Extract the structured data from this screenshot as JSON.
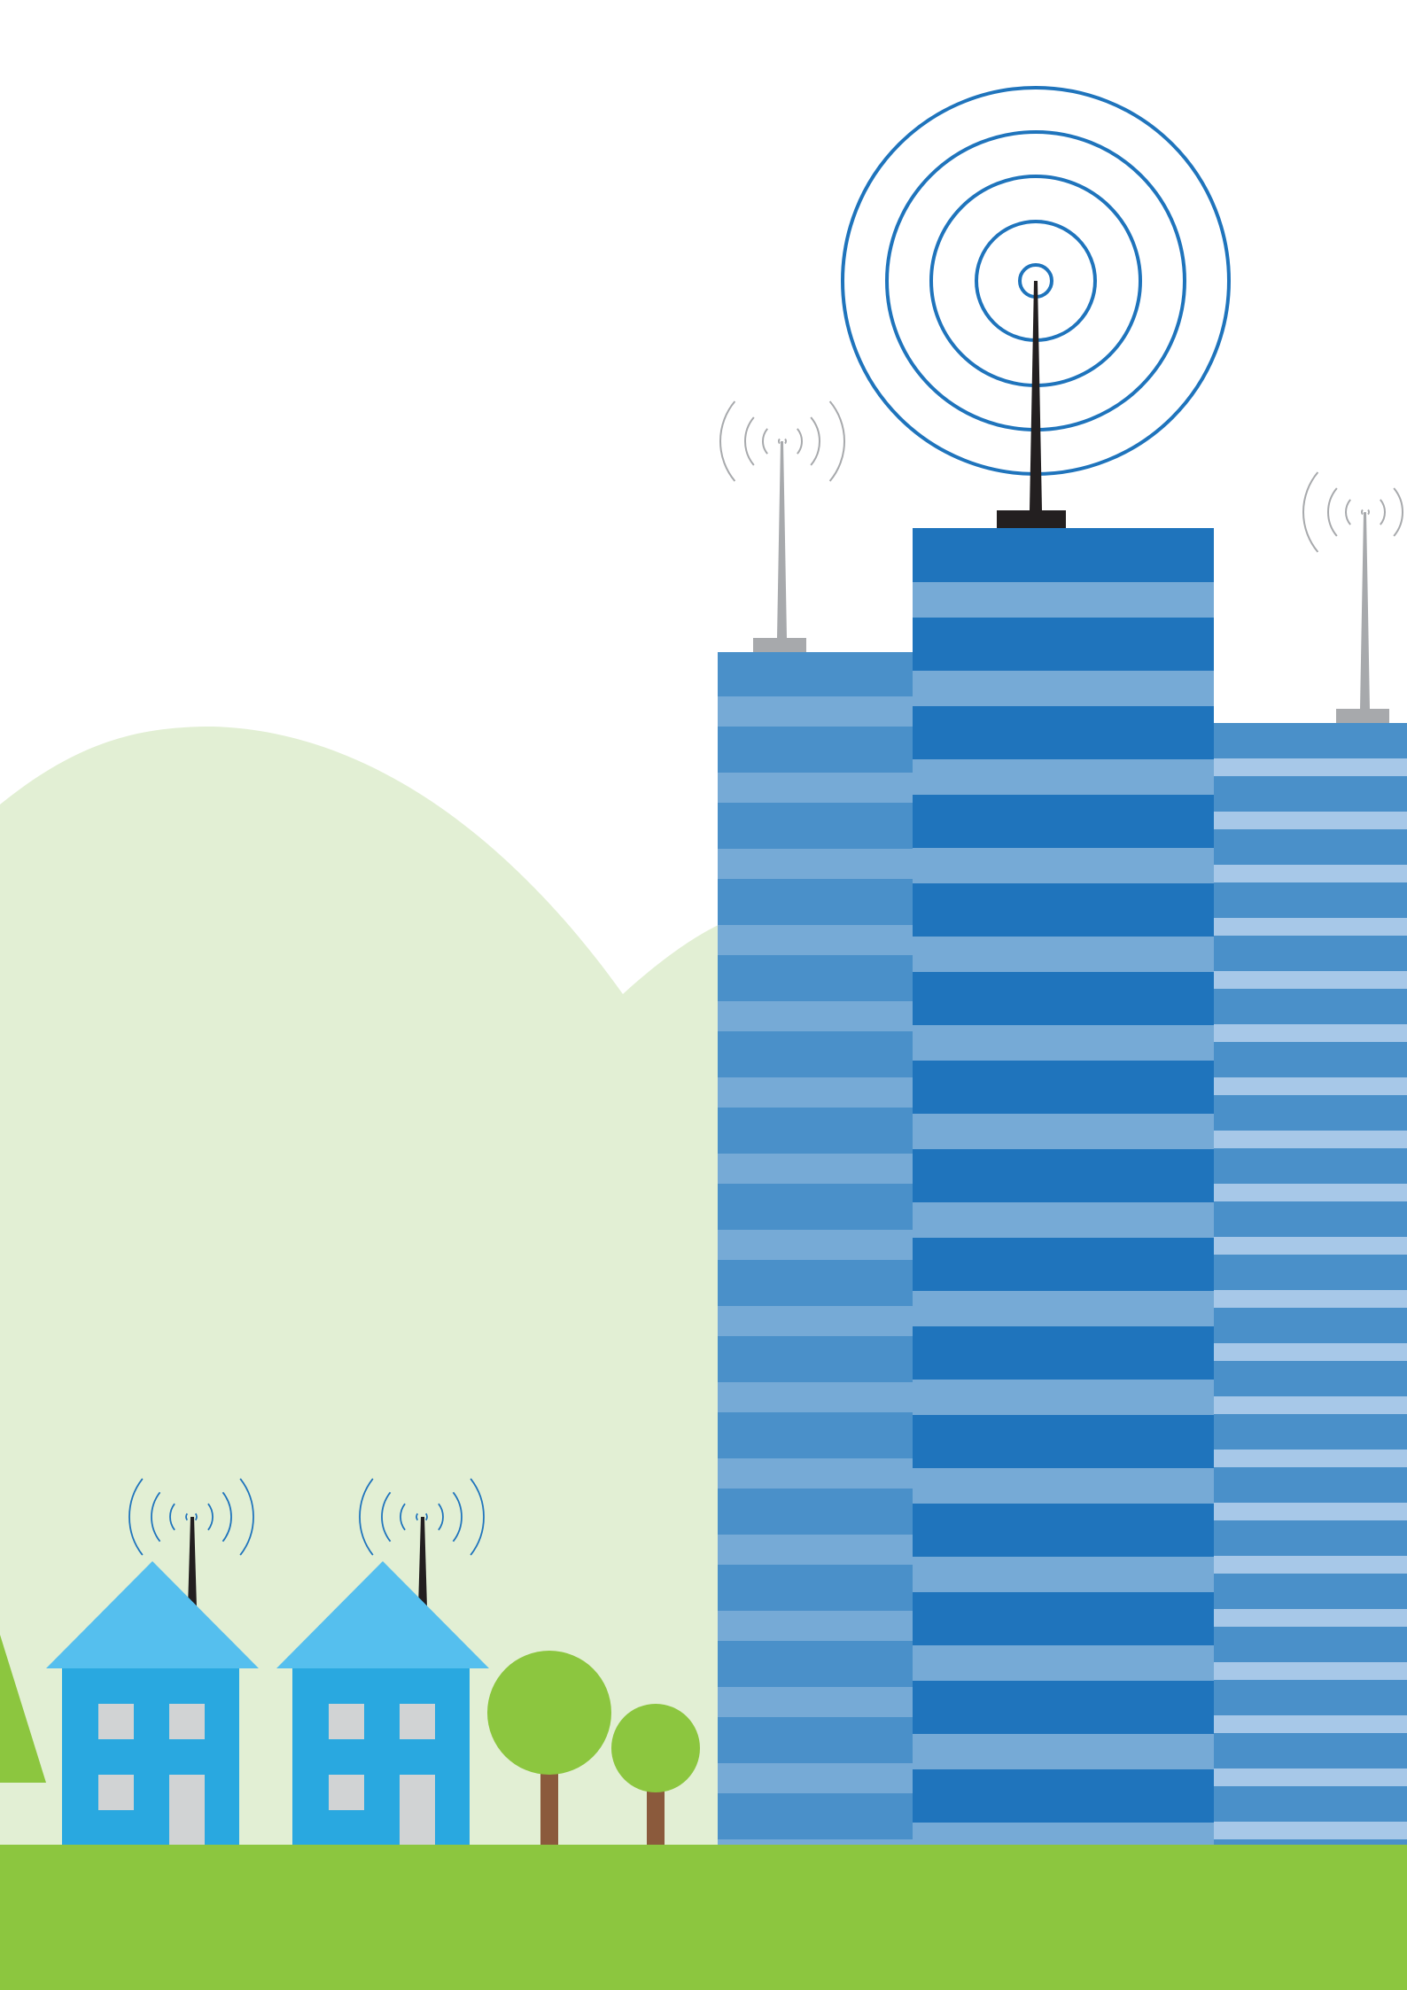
{
  "colors": {
    "background": "#ffffff",
    "hill": "#e2efd4",
    "grass": "#8cc63f",
    "tree_crown": "#8cc63f",
    "tree_trunk": "#8b5a3c",
    "house_roof": "#55bfee",
    "house_wall": "#29a8e0",
    "house_window": "#d1d3d4",
    "signal_blue": "#1f74bc",
    "signal_gray": "#a7a9ac",
    "antenna_dark": "#231f20",
    "left_tower_dark": "#4a90c9",
    "left_tower_light": "#76aad6",
    "center_tower_dark": "#1f74bc",
    "center_tower_light": "#76aad6",
    "right_tower_dark": "#4a90c9",
    "right_tower_light": "#a7c8e8"
  },
  "icons": {
    "broadcast_rings": "concentric-circles-icon",
    "signal_waves": "wifi-waves-icon"
  }
}
